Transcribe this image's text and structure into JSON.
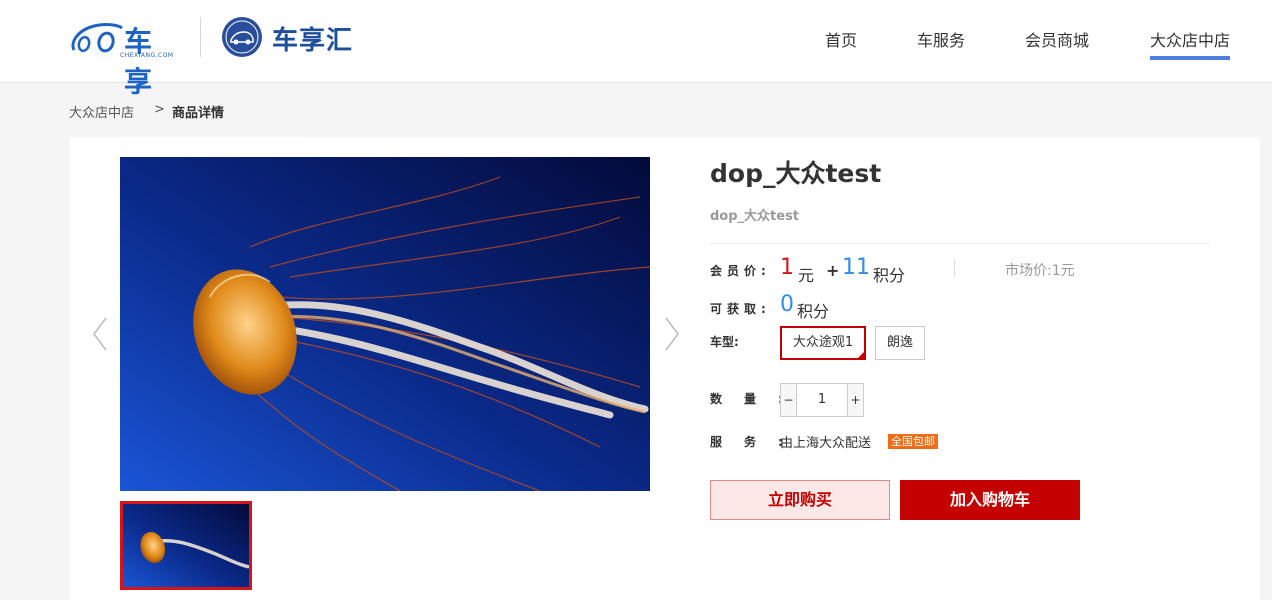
{
  "header": {
    "brand_logo_text": "车享",
    "brand_logo_sub": "CHEXIANG.COM",
    "club_logo_text": "车享汇",
    "nav": [
      {
        "label": "首页"
      },
      {
        "label": "车服务"
      },
      {
        "label": "会员商城"
      },
      {
        "label": "大众店中店",
        "active": true
      }
    ]
  },
  "breadcrumb": {
    "parent": "大众店中店",
    "separator": ">",
    "current": "商品详情"
  },
  "product": {
    "title": "dop_大众test",
    "subtitle": "dop_大众test",
    "member_price_label": "会员价:",
    "price_value": "1",
    "price_unit": "元",
    "plus": "+",
    "points_value": "11",
    "points_unit": "积分",
    "market_price": "市场价:1元",
    "earn_label": "可获取:",
    "earn_value": "0",
    "earn_unit": "积分",
    "car_model_label": "车型:",
    "car_models": [
      {
        "label": "大众途观1",
        "selected": true
      },
      {
        "label": "朗逸",
        "selected": false
      }
    ],
    "quantity_label": "数量:",
    "quantity_minus": "−",
    "quantity_value": "1",
    "quantity_plus": "+",
    "service_label": "服务:",
    "service_text": "由上海大众配送",
    "service_badge": "全国包邮",
    "buy_now_label": "立即购买",
    "add_cart_label": "加入购物车"
  },
  "colors": {
    "accent_red": "#c40000",
    "price_red": "#d7141a",
    "points_blue": "#2f8ee6",
    "nav_active_underline": "#4a7fe0",
    "badge_orange": "#f26b16"
  },
  "icons": {
    "prev": "chevron-left-icon",
    "next": "chevron-right-icon",
    "car_club_badge": "car-club-badge-icon"
  }
}
